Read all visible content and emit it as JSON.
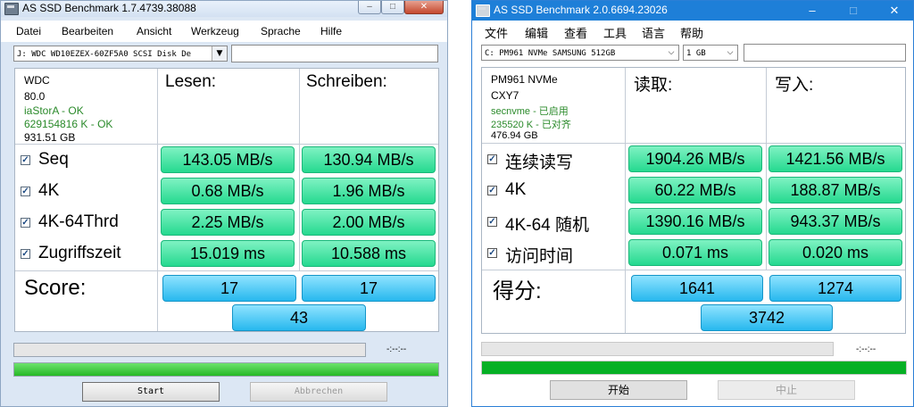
{
  "w1": {
    "title": "AS SSD Benchmark 1.7.4739.38088",
    "window_controls": {
      "minimize": "–",
      "maximize": "□",
      "close": "✕"
    },
    "menu": [
      "Datei",
      "Bearbeiten",
      "Ansicht",
      "Werkzeug",
      "Sprache",
      "Hilfe"
    ],
    "drive_select": "J: WDC WD10EZEX-60ZF5A0 SCSI Disk De",
    "info": [
      "WDC",
      "80.0",
      "iaStorA - OK",
      "629154816 K - OK",
      "931.51 GB"
    ],
    "col_read": "Lesen:",
    "col_write": "Schreiben:",
    "rows": [
      {
        "label": "Seq",
        "read": "143.05 MB/s",
        "write": "130.94 MB/s"
      },
      {
        "label": "4K",
        "read": "0.68 MB/s",
        "write": "1.96 MB/s"
      },
      {
        "label": "4K-64Thrd",
        "read": "2.25 MB/s",
        "write": "2.00 MB/s"
      },
      {
        "label": "Zugriffszeit",
        "read": "15.019 ms",
        "write": "10.588 ms"
      }
    ],
    "score_label": "Score:",
    "score_read": "17",
    "score_write": "17",
    "score_total": "43",
    "time": "-:--:--",
    "progress_top": 0.0,
    "progress_bottom": 1.0,
    "start": "Start",
    "abort": "Abbrechen"
  },
  "w2": {
    "title": "AS SSD Benchmark 2.0.6694.23026",
    "window_controls": {
      "minimize": "–",
      "maximize": "□",
      "close": "✕"
    },
    "menu": [
      "文件",
      "编辑",
      "查看",
      "工具",
      "语言",
      "帮助"
    ],
    "drive_select": "C: PM961 NVMe SAMSUNG 512GB",
    "size_select": "1 GB",
    "info": [
      "PM961 NVMe",
      "CXY7",
      "secnvme - 已启用",
      "235520 K - 已对齐",
      "476.94 GB"
    ],
    "col_read": "读取:",
    "col_write": "写入:",
    "rows": [
      {
        "label": "连续读写",
        "read": "1904.26 MB/s",
        "write": "1421.56 MB/s"
      },
      {
        "label": "4K",
        "read": "60.22 MB/s",
        "write": "188.87 MB/s"
      },
      {
        "label": "4K-64 随机",
        "read": "1390.16 MB/s",
        "write": "943.37 MB/s"
      },
      {
        "label": "访问时间",
        "read": "0.071 ms",
        "write": "0.020 ms"
      }
    ],
    "score_label": "得分:",
    "score_read": "1641",
    "score_write": "1274",
    "score_total": "3742",
    "time": "-:--:--",
    "progress_top": 0.0,
    "progress_bottom": 1.0,
    "start": "开始",
    "abort": "中止"
  }
}
